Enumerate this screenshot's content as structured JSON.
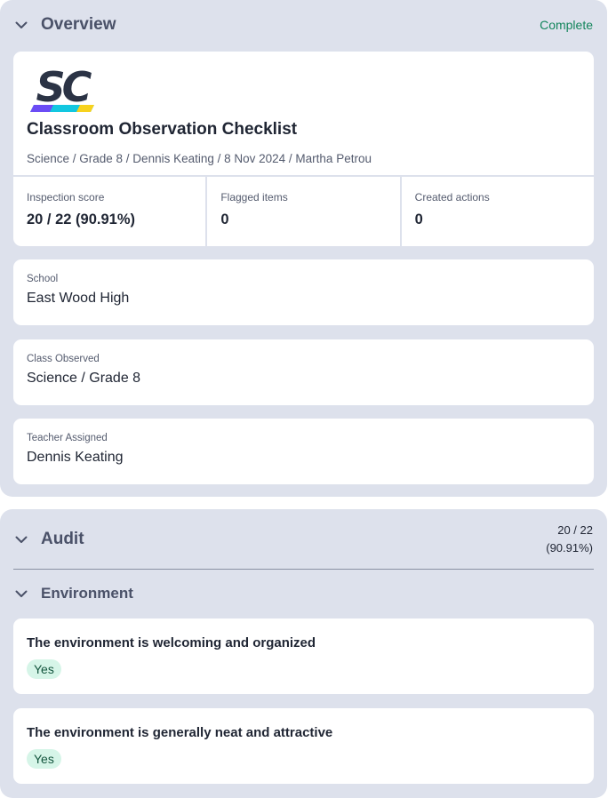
{
  "overview": {
    "title": "Overview",
    "status": "Complete",
    "document": {
      "logo_text": "SC",
      "title": "Classroom Observation Checklist",
      "meta": "Science / Grade 8 / Dennis Keating / 8 Nov 2024 / Martha Petrou"
    },
    "stats": [
      {
        "label": "Inspection score",
        "value": "20 / 22 (90.91%)"
      },
      {
        "label": "Flagged items",
        "value": "0"
      },
      {
        "label": "Created actions",
        "value": "0"
      }
    ],
    "fields": [
      {
        "label": "School",
        "value": "East Wood High"
      },
      {
        "label": "Class Observed",
        "value": "Science / Grade 8"
      },
      {
        "label": "Teacher Assigned",
        "value": "Dennis Keating"
      }
    ]
  },
  "audit": {
    "title": "Audit",
    "score_line1": "20 / 22",
    "score_line2": "(90.91%)",
    "subsection": {
      "title": "Environment",
      "questions": [
        {
          "text": "The environment is welcoming and organized",
          "answer": "Yes"
        },
        {
          "text": "The environment is generally neat and attractive",
          "answer": "Yes"
        }
      ]
    }
  },
  "colors": {
    "panel_bg": "#dde1ec",
    "complete_green": "#13855c",
    "badge_bg": "#d6f5e8",
    "logo_dark": "#2b3345",
    "logo_purple": "#6b4cf5",
    "logo_cyan": "#12c7e0",
    "logo_yellow": "#f7d21e"
  },
  "icons": {
    "collapse": "chevron-down-icon"
  }
}
